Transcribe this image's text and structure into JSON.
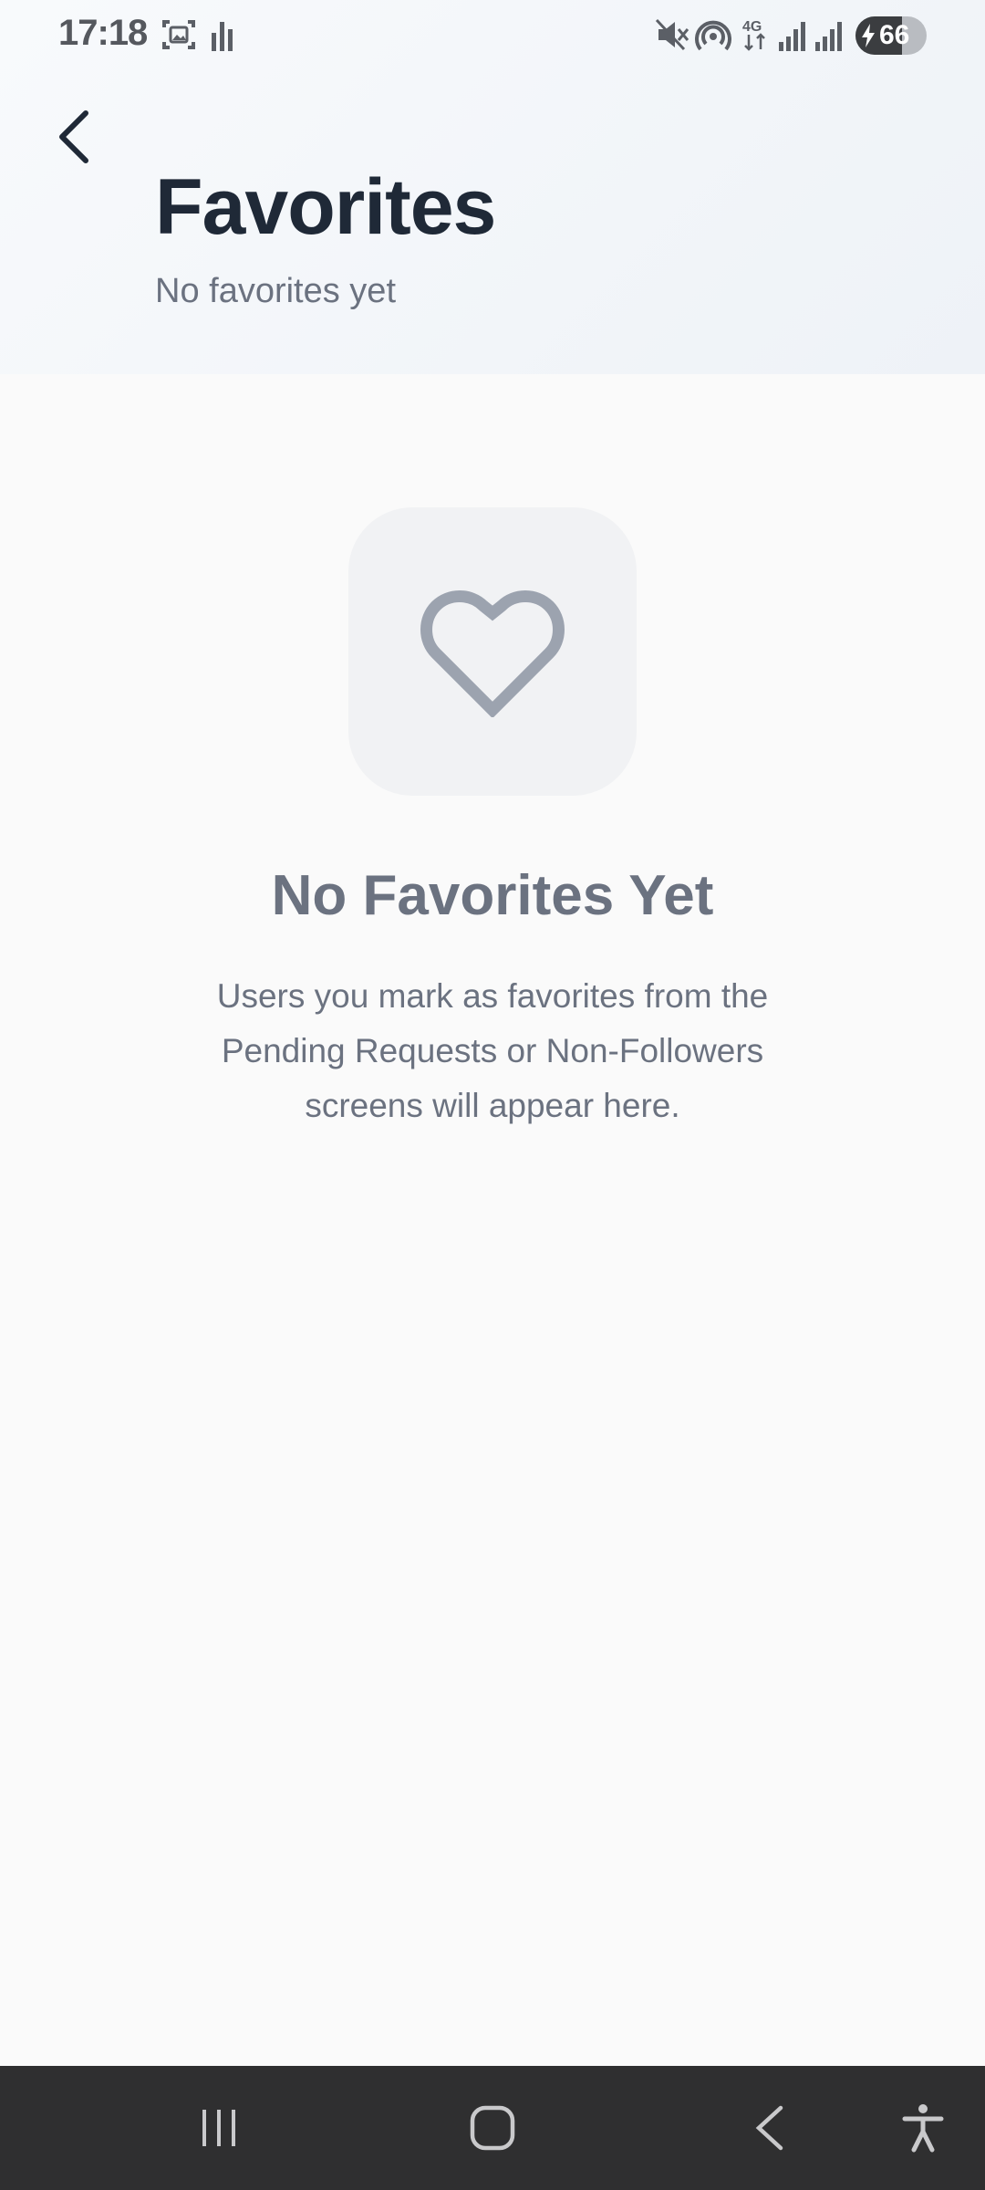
{
  "status_bar": {
    "time": "17:18",
    "battery_level": "66",
    "icons": [
      "screenshot-icon",
      "bars-icon",
      "mute-icon",
      "hotspot-icon",
      "network-4g-icon",
      "signal-icon",
      "signal-icon",
      "battery-icon"
    ]
  },
  "header": {
    "back_icon": "chevron-left-icon",
    "title": "Favorites",
    "subtitle": "No favorites yet"
  },
  "empty_state": {
    "icon": "heart-icon",
    "title": "No Favorites Yet",
    "description": "Users you mark as favorites from the Pending Requests or Non-Followers screens will appear here."
  },
  "nav_bar": {
    "items": [
      "recents-icon",
      "home-icon",
      "back-icon",
      "accessibility-icon"
    ]
  },
  "colors": {
    "title": "#1f2937",
    "muted_text": "#6b7280",
    "icon_gray": "#9ca3af",
    "nav_background": "#2f2f30"
  }
}
